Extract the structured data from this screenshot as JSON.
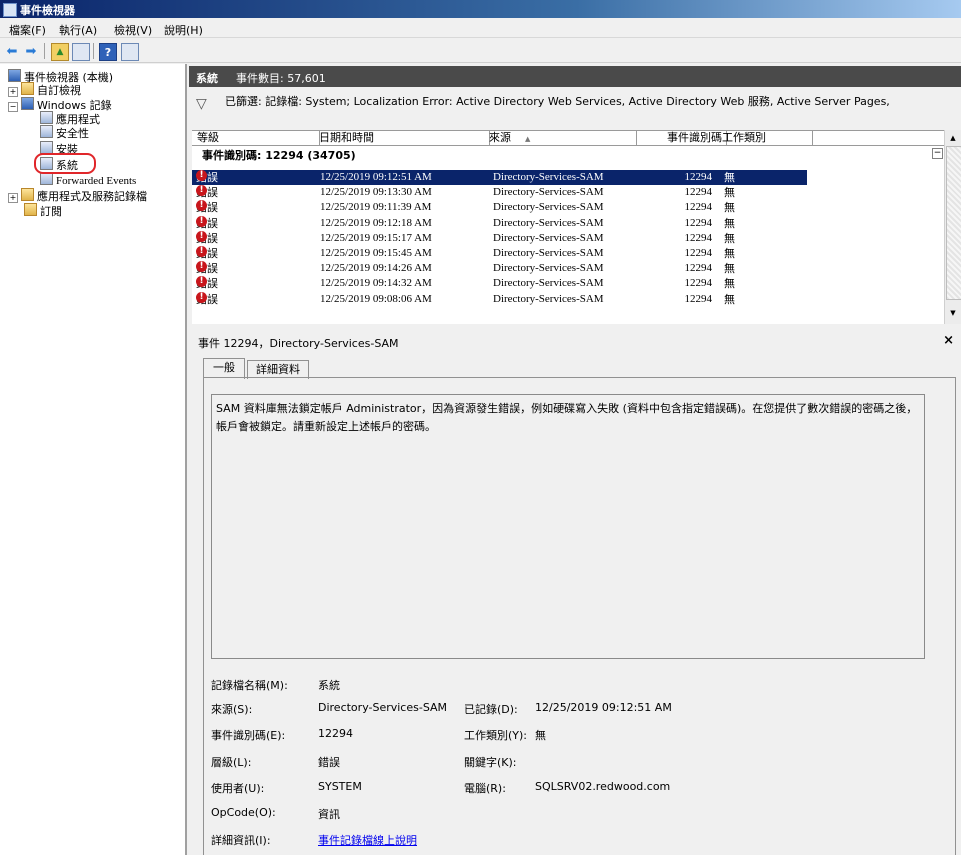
{
  "window": {
    "title": "事件檢視器"
  },
  "menu": [
    "檔案(F)",
    "執行(A)",
    "檢視(V)",
    "說明(H)"
  ],
  "toolbar": {
    "icons": [
      "back-icon",
      "forward-icon",
      "up-icon",
      "show-tree-icon",
      "help-icon",
      "action-pane-icon"
    ]
  },
  "tree": {
    "root": "事件檢視器 (本機)",
    "custom_views": "自訂檢視",
    "windows_logs": "Windows 記錄",
    "logs": [
      "應用程式",
      "安全性",
      "安裝",
      "系統",
      "Forwarded Events"
    ],
    "apps_services": "應用程式及服務記錄檔",
    "subscriptions": "訂閱"
  },
  "header": {
    "log_name": "系統",
    "count": "事件數目: 57,601"
  },
  "filter": {
    "text": "已篩選: 記錄檔: System; Localization Error: Active Directory Web Services, Active Directory Web 服務, Active Server Pages,"
  },
  "grid": {
    "columns": [
      "等級",
      "日期和時間",
      "來源",
      "事件識別碼",
      "工作類別"
    ],
    "sort_glyph": "▲",
    "group_header": "事件識別碼: 12294 (34705)",
    "collapse_glyph": "−",
    "rows": [
      {
        "level": "錯誤",
        "datetime": "12/25/2019 09:12:51 AM",
        "source": "Directory-Services-SAM",
        "id": "12294",
        "task": "無"
      },
      {
        "level": "錯誤",
        "datetime": "12/25/2019 09:13:30 AM",
        "source": "Directory-Services-SAM",
        "id": "12294",
        "task": "無"
      },
      {
        "level": "錯誤",
        "datetime": "12/25/2019 09:11:39 AM",
        "source": "Directory-Services-SAM",
        "id": "12294",
        "task": "無"
      },
      {
        "level": "錯誤",
        "datetime": "12/25/2019 09:12:18 AM",
        "source": "Directory-Services-SAM",
        "id": "12294",
        "task": "無"
      },
      {
        "level": "錯誤",
        "datetime": "12/25/2019 09:15:17 AM",
        "source": "Directory-Services-SAM",
        "id": "12294",
        "task": "無"
      },
      {
        "level": "錯誤",
        "datetime": "12/25/2019 09:15:45 AM",
        "source": "Directory-Services-SAM",
        "id": "12294",
        "task": "無"
      },
      {
        "level": "錯誤",
        "datetime": "12/25/2019 09:14:26 AM",
        "source": "Directory-Services-SAM",
        "id": "12294",
        "task": "無"
      },
      {
        "level": "錯誤",
        "datetime": "12/25/2019 09:14:32 AM",
        "source": "Directory-Services-SAM",
        "id": "12294",
        "task": "無"
      },
      {
        "level": "錯誤",
        "datetime": "12/25/2019 09:08:06 AM",
        "source": "Directory-Services-SAM",
        "id": "12294",
        "task": "無"
      }
    ]
  },
  "detail": {
    "title": "事件 12294，Directory-Services-SAM",
    "close": "×",
    "tabs": [
      "一般",
      "詳細資料"
    ],
    "description": "SAM 資料庫無法鎖定帳戶 Administrator，因為資源發生錯誤，例如硬碟寫入失敗 (資料中包含指定錯誤碼)。在您提供了數次錯誤的密碼之後，帳戶會被鎖定。請重新設定上述帳戶的密碼。",
    "fields": {
      "log_name_label": "記錄檔名稱(M):",
      "log_name": "系統",
      "source_label": "來源(S):",
      "source": "Directory-Services-SAM",
      "logged_label": "已記錄(D):",
      "logged": "12/25/2019 09:12:51 AM",
      "event_id_label": "事件識別碼(E):",
      "event_id": "12294",
      "task_label": "工作類別(Y):",
      "task": "無",
      "level_label": "層級(L):",
      "level": "錯誤",
      "keywords_label": "關鍵字(K):",
      "keywords": "",
      "user_label": "使用者(U):",
      "user": "SYSTEM",
      "computer_label": "電腦(R):",
      "computer": "SQLSRV02.redwood.com",
      "opcode_label": "OpCode(O):",
      "opcode": "資訊",
      "more_info_label": "詳細資訊(I):",
      "more_info_link": "事件記錄檔線上說明"
    }
  },
  "colors": {
    "selection": "#0a246a",
    "error": "#c8151b",
    "highlight_circle": "#e0262a",
    "header_bar": "#4a4a4a"
  }
}
